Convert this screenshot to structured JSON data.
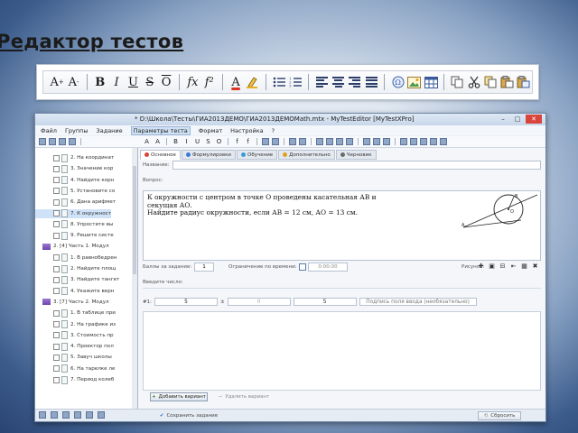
{
  "slide": {
    "title": "Редактор тестов"
  },
  "big_toolbar": {
    "sup_label": "A",
    "sub_label": "A",
    "bold": "B",
    "italic": "I",
    "underline": "U",
    "strike": "S",
    "overline": "O",
    "fx_sub": "fx",
    "fx_sup": "f²",
    "font_color": "A"
  },
  "window": {
    "title": "* D:\\Школа\\Тесты\\ГИА2013ДЕМО\\ГИА2013ДЕМОMath.mtx - MyTestEditor [MyTestXPro]",
    "menu": [
      "Файл",
      "Группы",
      "Задание",
      "Параметры теста",
      "Формат",
      "Настройка",
      "?"
    ]
  },
  "tree": {
    "items": [
      {
        "label": "2. На координат",
        "kind": "doc",
        "indent": 2
      },
      {
        "label": "3. Значение кор",
        "kind": "doc",
        "indent": 2
      },
      {
        "label": "4. Найдите корн",
        "kind": "doc",
        "indent": 2
      },
      {
        "label": "5. Установите со",
        "kind": "doc",
        "indent": 2
      },
      {
        "label": "6. Дана арифмет",
        "kind": "doc",
        "indent": 2
      },
      {
        "label": "7. К окружност",
        "kind": "doc",
        "indent": 2,
        "selected": true
      },
      {
        "label": "8. Упростите вы",
        "kind": "doc",
        "indent": 2
      },
      {
        "label": "9. Решите систе",
        "kind": "doc",
        "indent": 2
      },
      {
        "label": "2. [4] Часть 1. Модул",
        "kind": "folder",
        "indent": 1
      },
      {
        "label": "1. В равнобедрен",
        "kind": "doc",
        "indent": 2
      },
      {
        "label": "2. Найдите площ",
        "kind": "doc",
        "indent": 2
      },
      {
        "label": "3. Найдите тангет",
        "kind": "doc",
        "indent": 2
      },
      {
        "label": "4. Укажите верн",
        "kind": "doc",
        "indent": 2
      },
      {
        "label": "3. [7] Часть 2. Модул",
        "kind": "folder",
        "indent": 1
      },
      {
        "label": "1. В таблице при",
        "kind": "doc",
        "indent": 2
      },
      {
        "label": "2. На графике из",
        "kind": "doc",
        "indent": 2
      },
      {
        "label": "3. Стоимость пр",
        "kind": "doc",
        "indent": 2
      },
      {
        "label": "4. Проектор пол",
        "kind": "doc",
        "indent": 2
      },
      {
        "label": "5. Завуч школы",
        "kind": "doc",
        "indent": 2
      },
      {
        "label": "6. На тарелке ле",
        "kind": "doc",
        "indent": 2
      },
      {
        "label": "7. Период колеб",
        "kind": "doc",
        "indent": 2
      }
    ]
  },
  "editor": {
    "tabs": [
      {
        "label": "Основное",
        "color": "#d9453b",
        "active": true
      },
      {
        "label": "Формулировки",
        "color": "#3b7ad9"
      },
      {
        "label": "Обучение",
        "color": "#3b9ad9"
      },
      {
        "label": "Дополнительно",
        "color": "#e0a020"
      },
      {
        "label": "Черновик",
        "color": "#6a6a6a"
      }
    ],
    "name_label": "Название:",
    "question_label": "Вопрос:",
    "question_lines": [
      "К окружности с центром в точке О проведены касательная АВ и",
      "секущая АО.",
      "Найдите радиус окружности, если АВ = 12 см, АО = 13 см."
    ],
    "geom_labels": {
      "a": "A",
      "o": "O",
      "b": "B"
    },
    "score_label": "Баллы за задание:",
    "score_value": "1",
    "time_label": "Ограничение по времени:",
    "time_value": "0:00:00",
    "picture_label": "Рисунок:",
    "enter_number_label": "Введите число:",
    "variant_index": "#1:",
    "variant_value": "5",
    "variant_tolerance": "±",
    "variant_zero": "0",
    "variant_display": "5",
    "variant_caption": "Подпись поля ввода (необязательно)",
    "add_variant": "Добавить вариант",
    "remove_variant": "Удалить вариант",
    "save_task": "Сохранить задание",
    "reset": "Сбросить"
  }
}
